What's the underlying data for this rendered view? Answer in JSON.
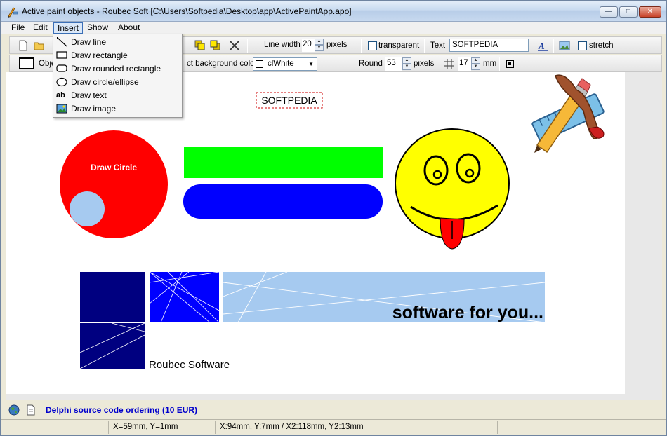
{
  "window": {
    "title": "Active paint objects - Roubec Soft [C:\\Users\\Softpedia\\Desktop\\app\\ActivePaintApp.apo]",
    "minimize": "—",
    "maximize": "□",
    "close": "✕"
  },
  "menubar": [
    "File",
    "Edit",
    "Insert",
    "Show",
    "About"
  ],
  "insert_menu": [
    {
      "label": "Draw line",
      "icon": "line-icon"
    },
    {
      "label": "Draw rectangle",
      "icon": "rectangle-icon"
    },
    {
      "label": "Draw rounded rectangle",
      "icon": "rounded-rectangle-icon"
    },
    {
      "label": "Draw circle/ellipse",
      "icon": "ellipse-icon"
    },
    {
      "label": "Draw text",
      "icon": "text-icon"
    },
    {
      "label": "Draw image",
      "icon": "image-icon"
    }
  ],
  "toolbar1": {
    "line_width_label": "Line width",
    "line_width_value": "20",
    "pixels_label": "pixels",
    "transparent_label": "transparent",
    "text_label": "Text",
    "text_value": "SOFTPEDIA",
    "stretch_label": "stretch"
  },
  "toolbar2": {
    "object_label": "Obje",
    "bg_label": "ct background color",
    "bg_color_value": "clWhite",
    "round_label": "Round",
    "round_value": "53",
    "round_units": "pixels",
    "grid_value": "17",
    "grid_units": "mm"
  },
  "canvas": {
    "softpedia_text": "SOFTPEDIA",
    "circle_label": "Draw Circle",
    "slogan": "software for you...",
    "company": "Roubec Software",
    "colors": {
      "red": "#ff0000",
      "green": "#00ff00",
      "blue": "#0000ff",
      "yellow": "#ffff00",
      "navy": "#000080",
      "lightblue": "#a6caf0"
    }
  },
  "linkbar": {
    "link_text": "Delphi source code ordering (10 EUR)"
  },
  "statusbar": {
    "pos": "X=59mm, Y=1mm",
    "selection": "X:94mm, Y:7mm / X2:118mm, Y2:13mm"
  }
}
